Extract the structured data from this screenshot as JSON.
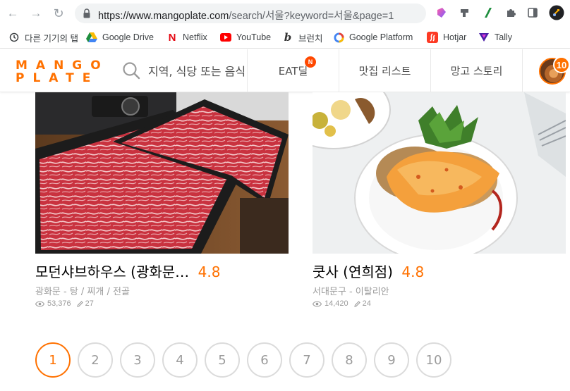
{
  "browser": {
    "url_host": "https://www.mangoplate.com",
    "url_path": "/search/서울?keyword=서울&page=1",
    "bookmarks": [
      {
        "label": "다른 기기의 탭",
        "icon": "history-icon"
      },
      {
        "label": "Google Drive",
        "icon": "google-drive-icon"
      },
      {
        "label": "Netflix",
        "icon": "netflix-icon"
      },
      {
        "label": "YouTube",
        "icon": "youtube-icon"
      },
      {
        "label": "브런치",
        "icon": "brunch-icon"
      },
      {
        "label": "Google Platform",
        "icon": "google-platform-icon"
      },
      {
        "label": "Hotjar",
        "icon": "hotjar-icon"
      },
      {
        "label": "Tally",
        "icon": "tally-icon"
      }
    ]
  },
  "header": {
    "logo_top": "MANGO",
    "logo_bottom": "PLATE",
    "search_placeholder": "지역, 식당 또는 음식",
    "nav": [
      {
        "label": "EAT딜",
        "badge": "N"
      },
      {
        "label": "맛집 리스트"
      },
      {
        "label": "망고 스토리"
      }
    ],
    "notification_count": "10"
  },
  "restaurants": [
    {
      "name": "모던샤브하우스 (광화문…",
      "rating": "4.8",
      "meta": "광화문 - 탕 / 찌개 / 전골",
      "views": "53,376",
      "reviews": "27",
      "photo": "shabu-beef-tray"
    },
    {
      "name": "쿳사 (연희점)",
      "rating": "4.8",
      "meta": "서대문구 - 이탈리안",
      "views": "14,420",
      "reviews": "24",
      "photo": "brunch-plate"
    }
  ],
  "pagination": {
    "pages": [
      "1",
      "2",
      "3",
      "4",
      "5",
      "6",
      "7",
      "8",
      "9",
      "10"
    ],
    "current": "1"
  },
  "colors": {
    "brand": "#ff7100",
    "muted": "#9b9b9b",
    "border": "#dbdbdb"
  }
}
